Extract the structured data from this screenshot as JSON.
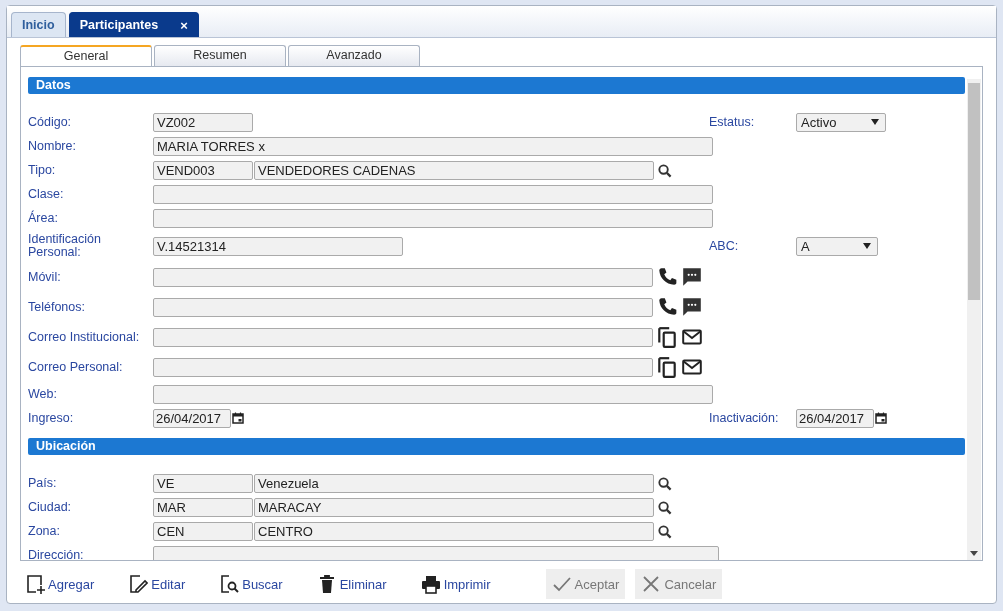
{
  "tabs": [
    {
      "label": "Inicio",
      "selected": false
    },
    {
      "label": "Participantes",
      "selected": true,
      "close": "×"
    }
  ],
  "subtabs": [
    {
      "label": "General",
      "selected": true
    },
    {
      "label": "Resumen",
      "selected": false
    },
    {
      "label": "Avanzado",
      "selected": false
    }
  ],
  "sections": [
    {
      "title": "Datos",
      "rows": [
        {
          "label": "Código:",
          "kind": "short",
          "values": [
            "VZ002"
          ],
          "right": {
            "label": "Estatus:",
            "kind": "select",
            "value": "Activo"
          }
        },
        {
          "label": "Nombre:",
          "kind": "text",
          "values": [
            "MARIA TORRES x"
          ]
        },
        {
          "label": "Tipo:",
          "kind": "lookup",
          "values": [
            "VEND003",
            "VENDEDORES CADENAS"
          ]
        },
        {
          "label": "Clase:",
          "kind": "text"
        },
        {
          "label": "Área:",
          "kind": "text"
        },
        {
          "label": "Identificación Personal:",
          "kind": "id",
          "values": [
            "V.14521314"
          ],
          "right": {
            "label": "ABC:",
            "kind": "select-small",
            "value": "A"
          }
        },
        {
          "label": "Móvil:",
          "kind": "phone"
        },
        {
          "label": "Teléfonos:",
          "kind": "phone"
        },
        {
          "label": "Correo Institucional:",
          "kind": "email"
        },
        {
          "label": "Correo Personal:",
          "kind": "email"
        },
        {
          "label": "Web:",
          "kind": "text"
        },
        {
          "label": "Ingreso:",
          "kind": "date",
          "values": [
            "26/04/2017"
          ],
          "right": {
            "label": "Inactivación:",
            "kind": "date",
            "value": "26/04/2017"
          }
        }
      ]
    },
    {
      "title": "Ubicación",
      "rows": [
        {
          "label": "País:",
          "kind": "lookup",
          "values": [
            "VE",
            "Venezuela"
          ]
        },
        {
          "label": "Ciudad:",
          "kind": "lookup",
          "values": [
            "MAR",
            "MARACAY"
          ]
        },
        {
          "label": "Zona:",
          "kind": "lookup",
          "values": [
            "CEN",
            "CENTRO"
          ]
        },
        {
          "label": "Dirección:",
          "kind": "address"
        }
      ]
    }
  ],
  "toolbar": [
    {
      "kind": "add",
      "label": "Agregar",
      "disabled": false
    },
    {
      "kind": "edit",
      "label": "Editar",
      "disabled": false
    },
    {
      "kind": "find",
      "label": "Buscar",
      "disabled": false
    },
    {
      "kind": "delete",
      "label": "Eliminar",
      "disabled": false
    },
    {
      "kind": "print",
      "label": "Imprimir",
      "disabled": false
    },
    {
      "kind": "accept",
      "label": "Aceptar",
      "disabled": true
    },
    {
      "kind": "cancel",
      "label": "Cancelar",
      "disabled": true
    }
  ]
}
